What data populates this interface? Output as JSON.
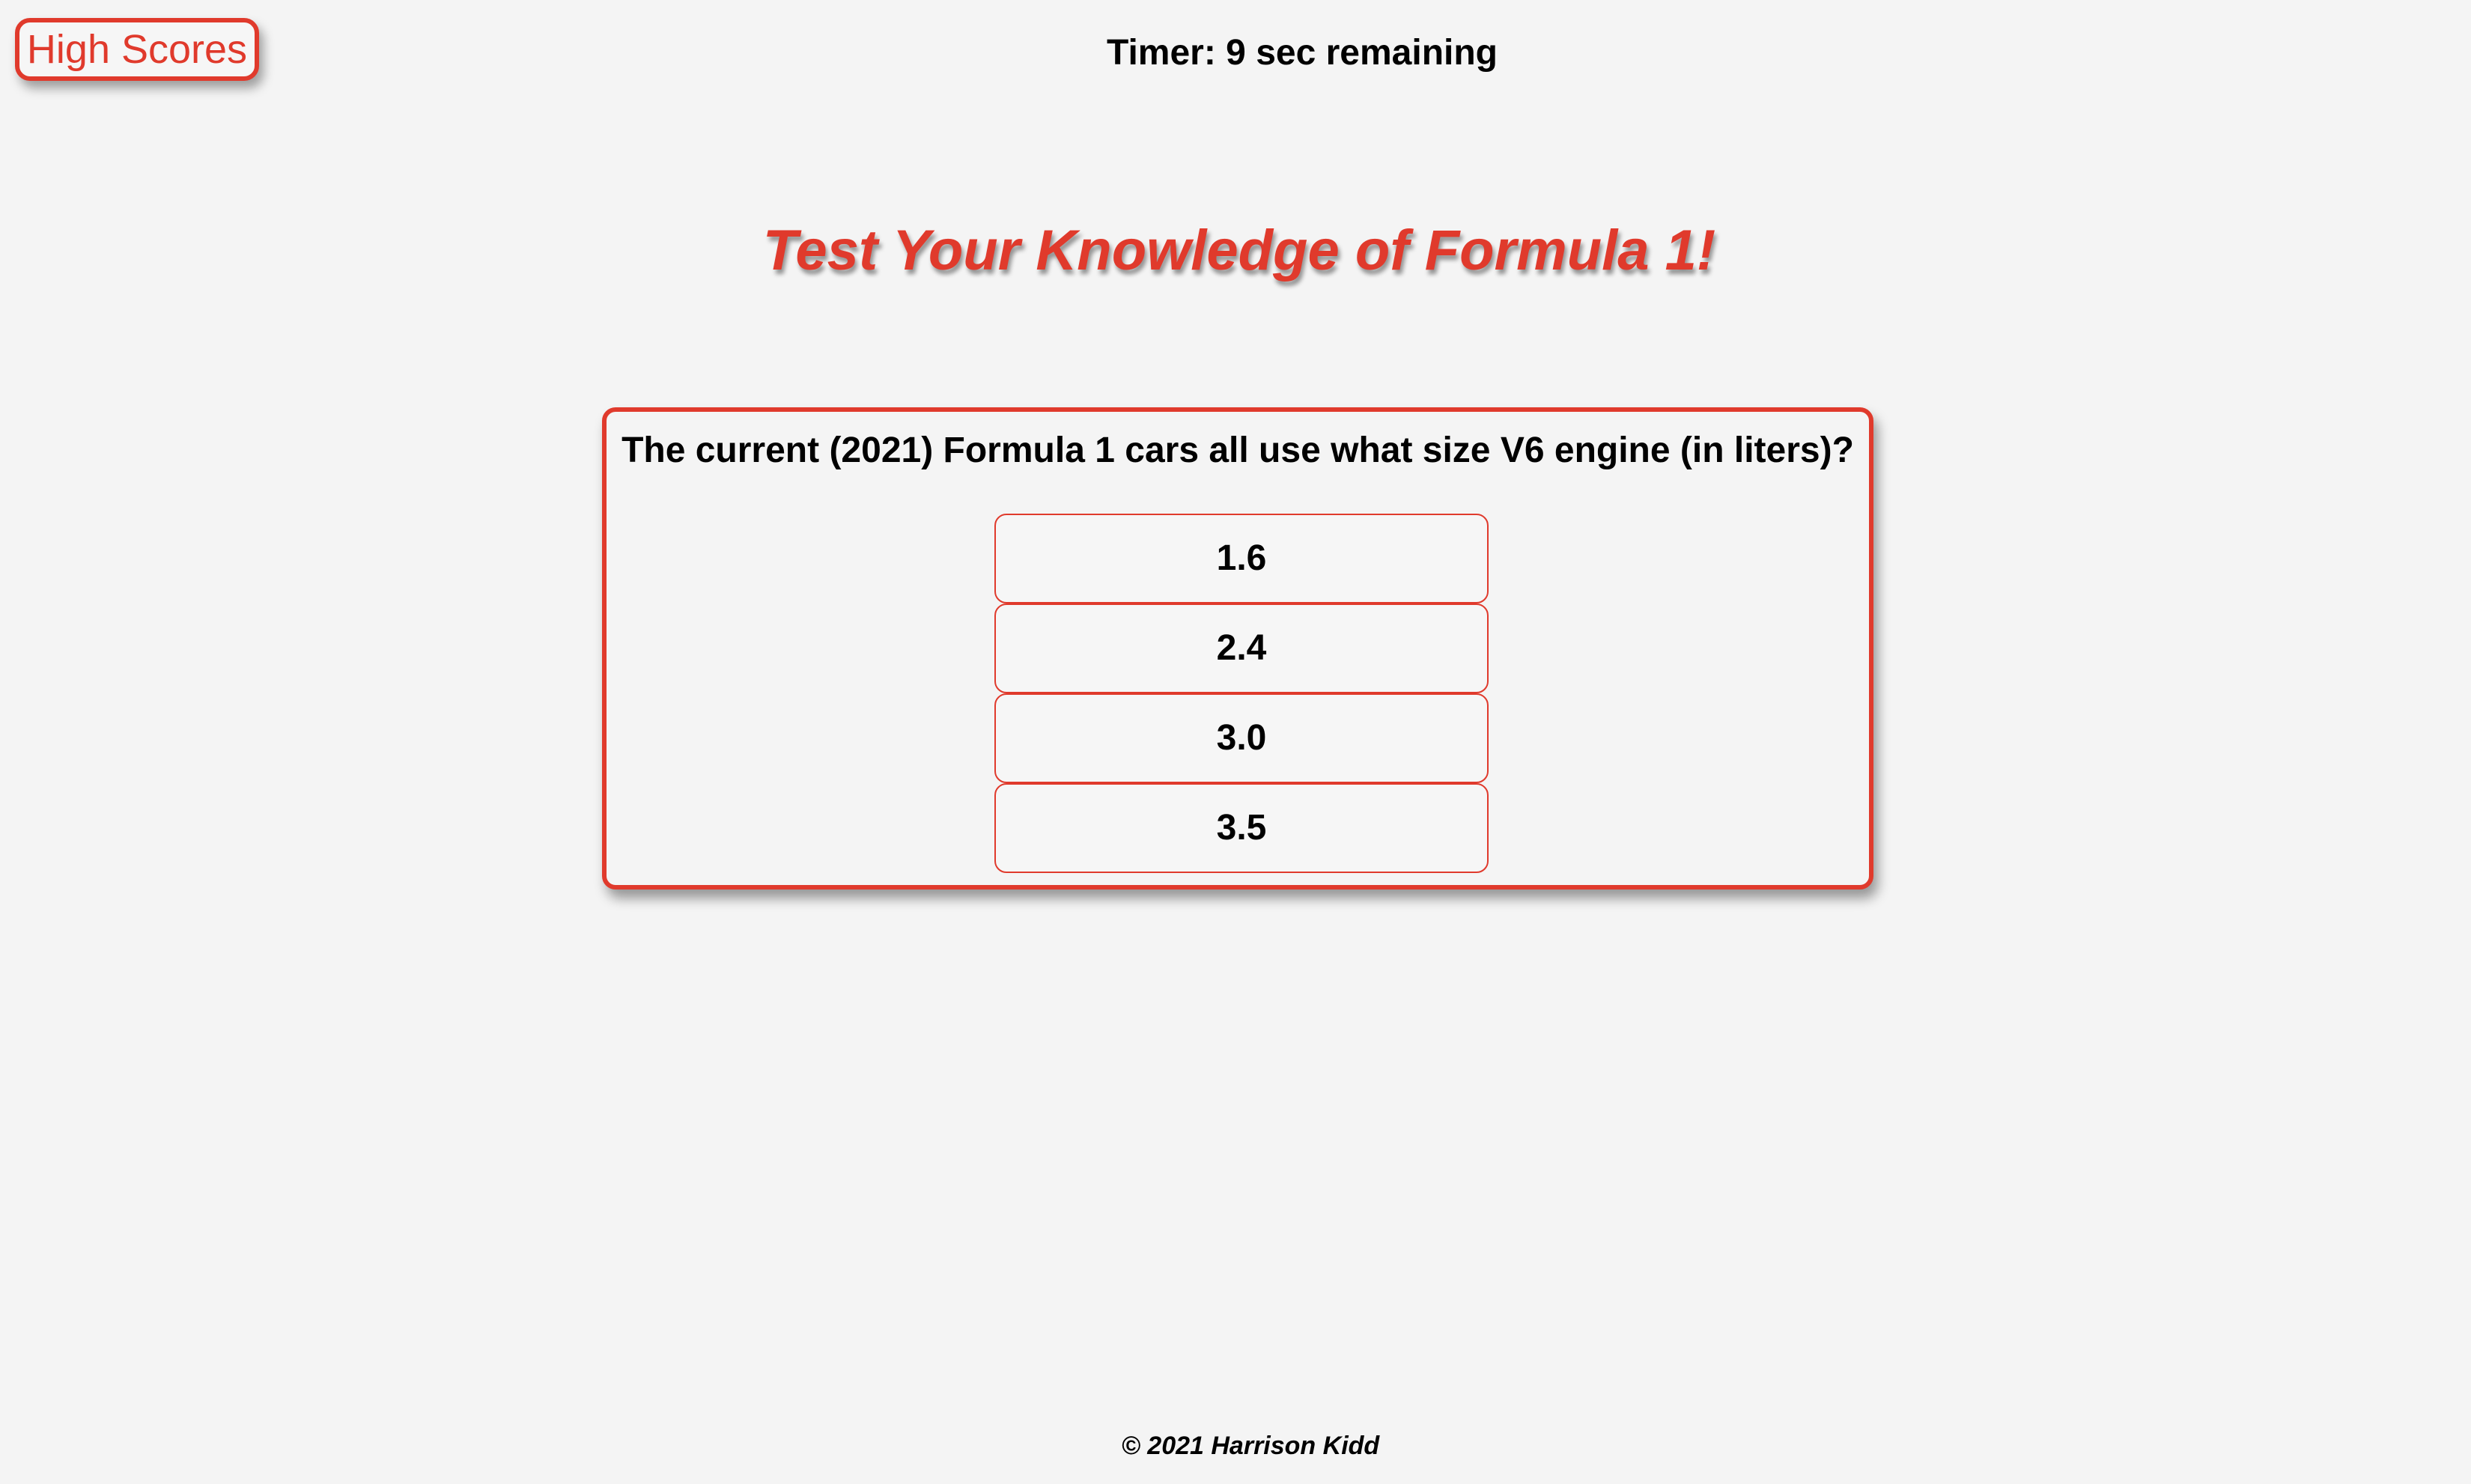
{
  "header": {
    "high_scores_label": "High Scores",
    "timer_text": "Timer: 9 sec remaining"
  },
  "main": {
    "title": "Test Your Knowledge of Formula 1!",
    "question": "The current (2021) Formula 1 cars all use what size V6 engine (in liters)?",
    "answers": [
      "1.6",
      "2.4",
      "3.0",
      "3.5"
    ]
  },
  "footer": {
    "copyright": "© 2021 Harrison Kidd"
  },
  "colors": {
    "accent": "#e03a2c",
    "background": "#f4f4f4"
  }
}
